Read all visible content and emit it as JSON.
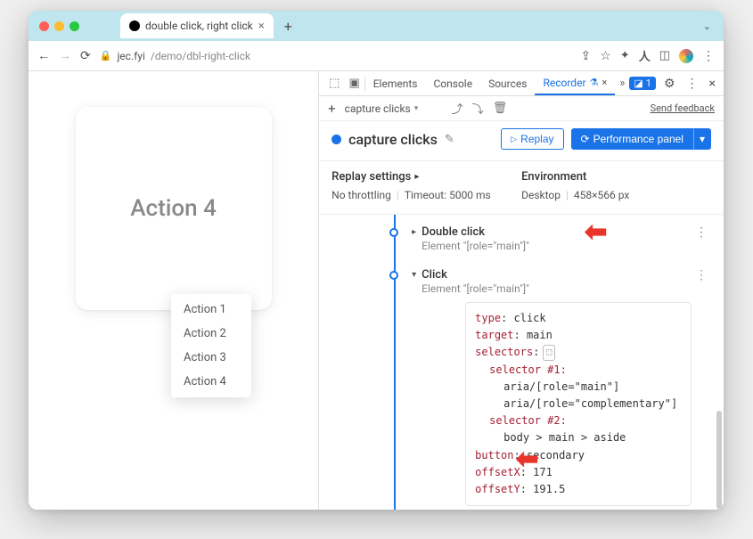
{
  "browser": {
    "tab_title": "double click, right click",
    "url_host": "jec.fyi",
    "url_path": "/demo/dbl-right-click"
  },
  "page": {
    "card_label": "Action 4",
    "menu": [
      "Action 1",
      "Action 2",
      "Action 3",
      "Action 4"
    ]
  },
  "devtools": {
    "tabs": {
      "elements": "Elements",
      "console": "Console",
      "sources": "Sources",
      "recorder": "Recorder"
    },
    "issues_count": "1",
    "subbar": {
      "recording_select": "capture clicks",
      "feedback": "Send feedback"
    },
    "recording": {
      "title": "capture clicks",
      "replay": "Replay",
      "perf_panel": "Performance panel"
    },
    "settings": {
      "replay_h": "Replay settings",
      "throttle": "No throttling",
      "timeout": "Timeout: 5000 ms",
      "env_h": "Environment",
      "device": "Desktop",
      "viewport": "458×566 px"
    },
    "steps": {
      "s1": {
        "title": "Double click",
        "sub": "Element \"[role=\"main\"]\""
      },
      "s2": {
        "title": "Click",
        "sub": "Element \"[role=\"main\"]\""
      },
      "detail": {
        "type_k": "type",
        "type_v": ": click",
        "target_k": "target",
        "target_v": ": main",
        "selectors_k": "selectors",
        "selectors_v": ":",
        "sel1": "selector #1:",
        "sel1a": "aria/[role=\"main\"]",
        "sel1b": "aria/[role=\"complementary\"]",
        "sel2": "selector #2:",
        "sel2a": "body > main > aside",
        "button_k": "button",
        "button_v": ": secondary",
        "offx_k": "offsetX",
        "offx_v": ": 171",
        "offy_k": "offsetY",
        "offy_v": ": 191.5"
      }
    }
  }
}
